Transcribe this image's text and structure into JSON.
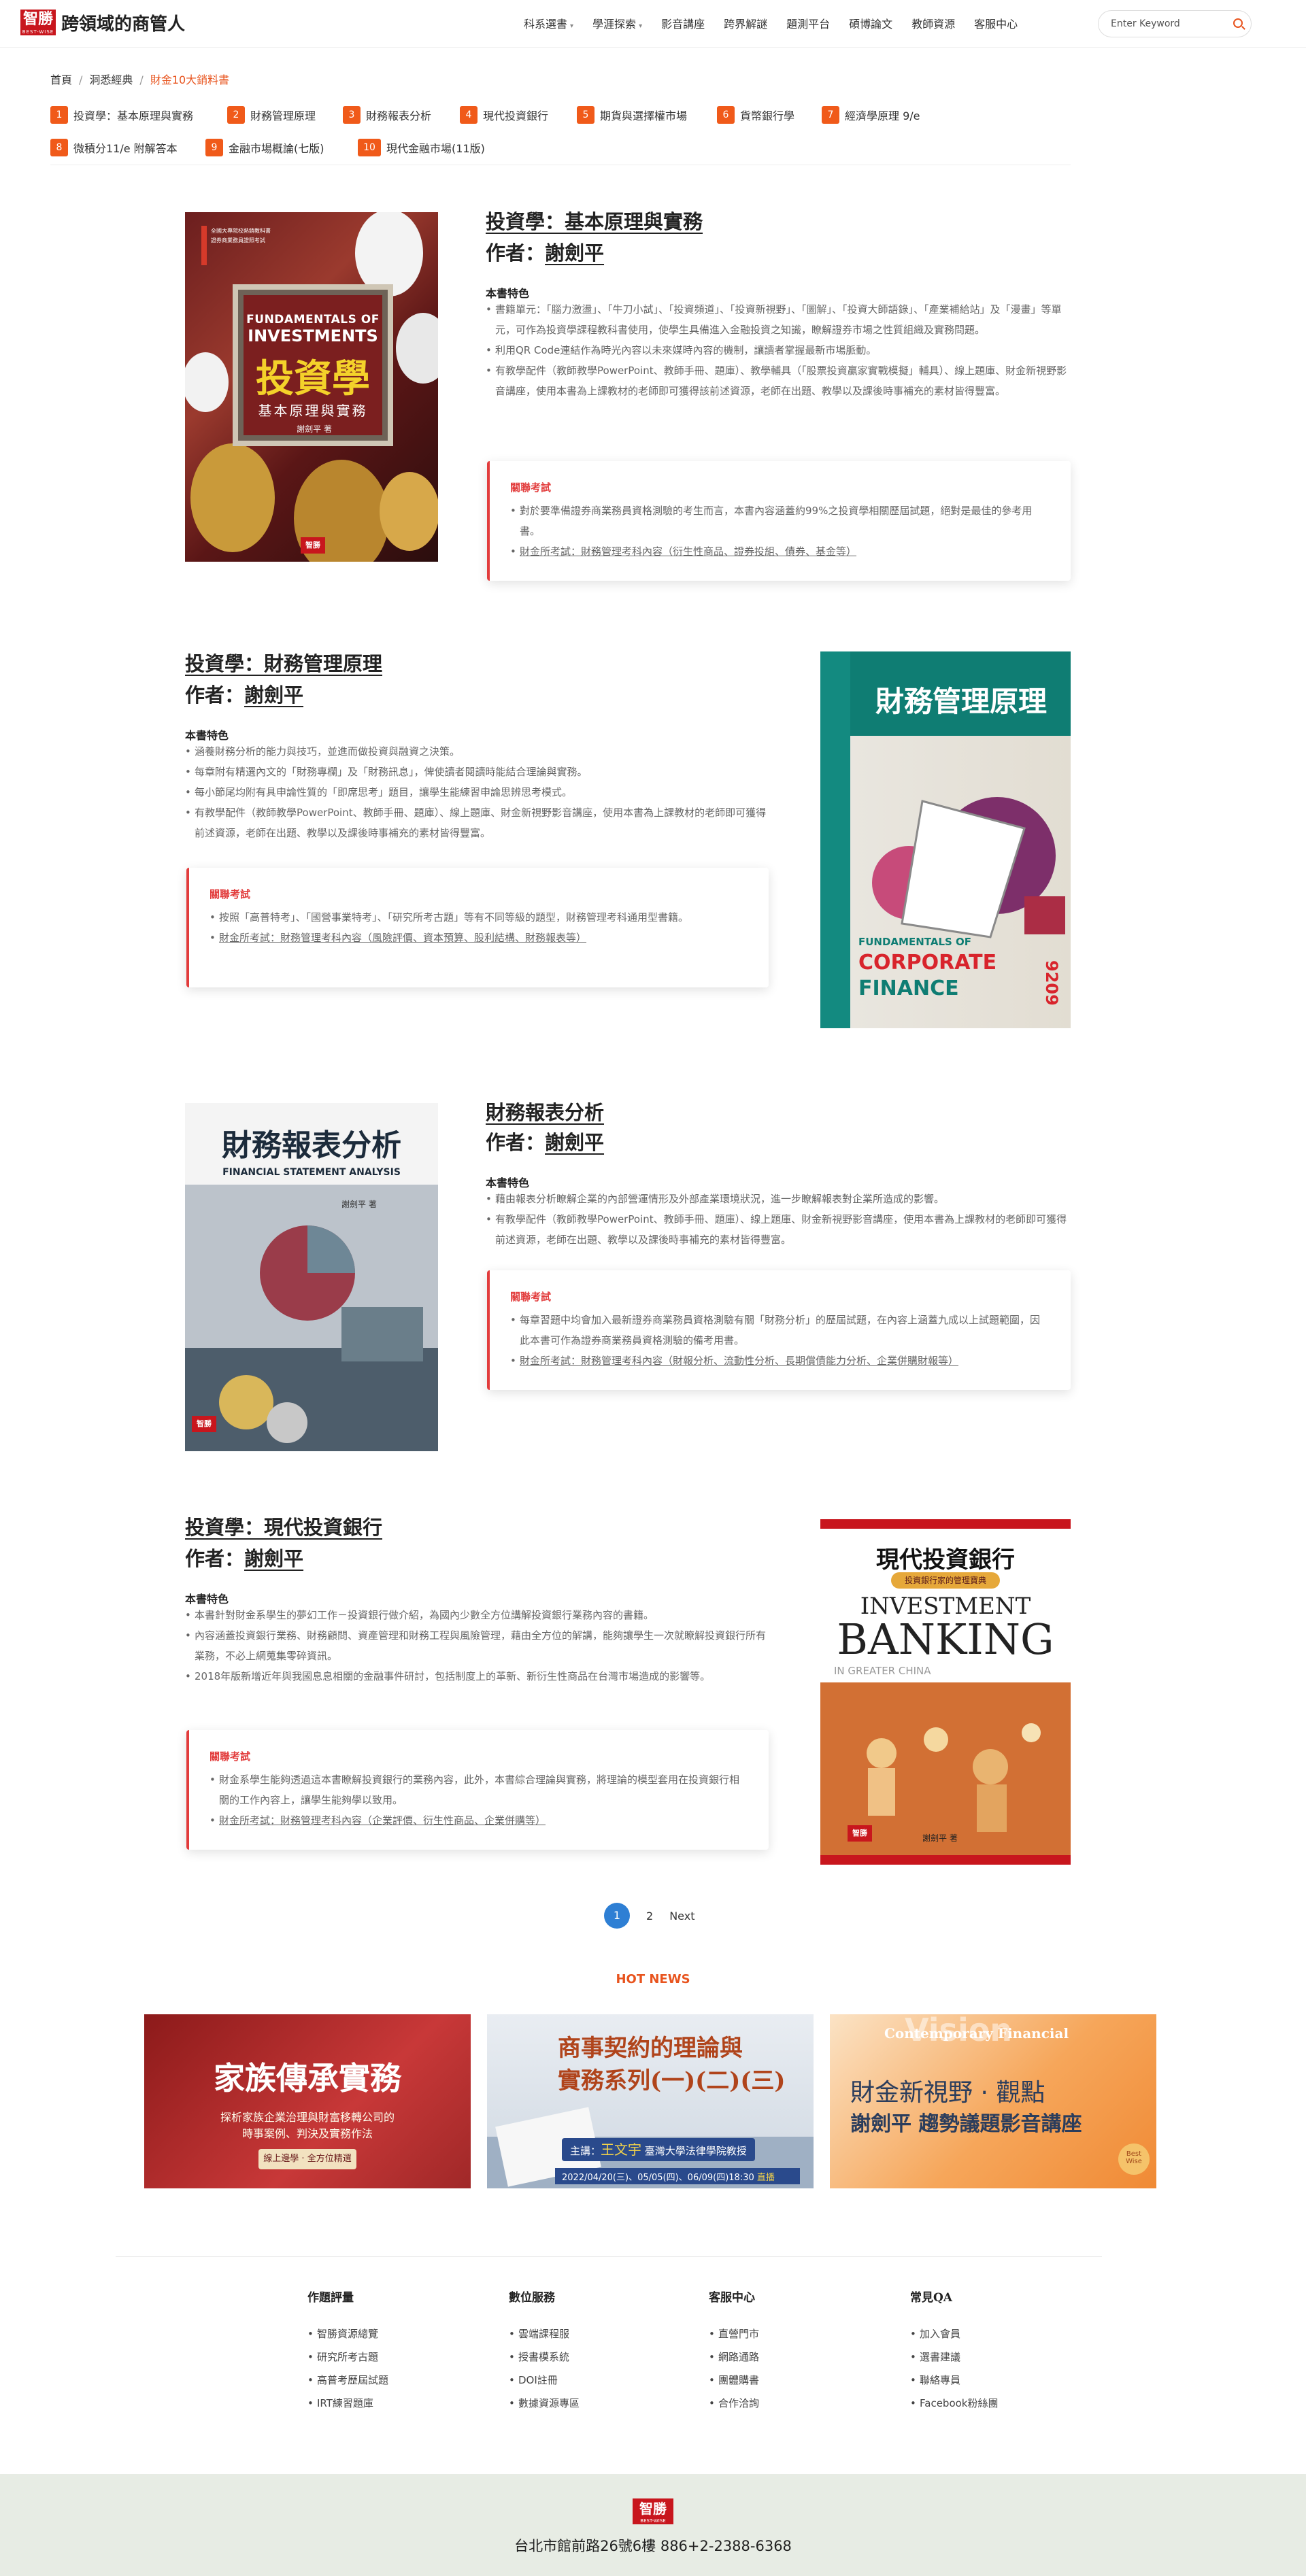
{
  "header": {
    "logo_badge": "智勝",
    "logo_sub": "BEST-WISE",
    "site_name": "跨領域的商管人",
    "nav": [
      {
        "label": "科系選書",
        "dropdown": true
      },
      {
        "label": "學涯探索",
        "dropdown": true
      },
      {
        "label": "影音講座",
        "dropdown": false
      },
      {
        "label": "跨界解謎",
        "dropdown": false
      },
      {
        "label": "題測平台",
        "dropdown": false
      },
      {
        "label": "碩博論文",
        "dropdown": false
      },
      {
        "label": "教師資源",
        "dropdown": false
      },
      {
        "label": "客服中心",
        "dropdown": false
      }
    ],
    "search_placeholder": "Enter Keyword"
  },
  "breadcrumb": {
    "home": "首頁",
    "section": "洞悉經典",
    "current": "財金10大銷料書"
  },
  "tags": [
    {
      "num": "1",
      "label": "投資學：基本原理與實務"
    },
    {
      "num": "2",
      "label": "財務管理原理"
    },
    {
      "num": "3",
      "label": "財務報表分析"
    },
    {
      "num": "4",
      "label": "現代投資銀行"
    },
    {
      "num": "5",
      "label": "期貨與選擇權市場"
    },
    {
      "num": "6",
      "label": "貨幣銀行學"
    },
    {
      "num": "7",
      "label": "經濟學原理 9/e"
    },
    {
      "num": "8",
      "label": "微積分11/e 附解答本"
    },
    {
      "num": "9",
      "label": "金融市場概論(七版)"
    },
    {
      "num": "10",
      "label": "現代金融市場(11版)"
    }
  ],
  "books": [
    {
      "title": "投資學：基本原理與實務",
      "author_prefix": "作者：",
      "author": "謝劍平",
      "feat_head": "本書特色",
      "features": [
        "書籍單元：「腦力激盪」、「牛刀小試」、「投資頻道」、「投資新視野」、「圖解」、「投資大師語錄」、「產業補給站」及「漫畫」等單元，可作為投資學課程教科書使用，使學生具備進入金融投資之知識，瞭解證券市場之性質組織及實務問題。",
        "利用QR Code連結作為時光內容以未來媒時內容的機制，讓讀者掌握最新市場脈動。",
        "有教學配件（教師教學PowerPoint、教師手冊、題庫）、教學輔具（「股票投資贏家實戰模擬」輔具）、線上題庫、財金新視野影音講座，使用本書為上課教材的老師即可獲得該前述資源，老師在出題、教學以及課後時事補充的素材皆得豐富。"
      ],
      "exam_title": "關聯考試",
      "exam_items": [
        "對於要準備證券商業務員資格測驗的考生而言，本書內容涵蓋約99%之投資學相關歷屆試題，絕對是最佳的參考用書。",
        "財金所考試：財務管理考科內容（衍生性商品、證券投組、債券、基金等）"
      ],
      "cover": {
        "en1": "FUNDAMENTALS OF",
        "en2": "INVESTMENTS",
        "zh": "投資學",
        "sub": "基本原理與實務",
        "author": "謝劍平 著"
      }
    },
    {
      "title": "投資學：財務管理原理",
      "author_prefix": "作者：",
      "author": "謝劍平",
      "feat_head": "本書特色",
      "features": [
        "涵養財務分析的能力與技巧，並進而做投資與融資之決策。",
        "每章附有精選內文的「財務專欄」及「財務訊息」，俾使讀者閱讀時能結合理論與實務。",
        "每小節尾均附有具申論性質的「即席思考」題目，讓學生能練習申論思辨思考模式。",
        "有教學配件（教師教學PowerPoint、教師手冊、題庫）、線上題庫、財金新視野影音講座，使用本書為上課教材的老師即可獲得前述資源，老師在出題、教學以及課後時事補充的素材皆得豐富。"
      ],
      "exam_title": "關聯考試",
      "exam_items": [
        "按照「高普特考」、「國營事業特考」、「研究所考古題」等有不同等級的題型，財務管理考科通用型書籍。",
        "財金所考試：財務管理考科內容（風險評價、資本預算、股利結構、財務報表等）"
      ],
      "cover": {
        "zh": "財務管理原理",
        "en1": "FUNDAMENTALS OF",
        "en2": "CORPORATE",
        "en3": "FINANCE",
        "edition": "9209"
      }
    },
    {
      "title": "財務報表分析",
      "author_prefix": "作者：",
      "author": "謝劍平",
      "feat_head": "本書特色",
      "features": [
        "藉由報表分析瞭解企業的內部營運情形及外部產業環境狀況，進一步瞭解報表對企業所造成的影響。",
        "有教學配件（教師教學PowerPoint、教師手冊、題庫）、線上題庫、財金新視野影音講座，使用本書為上課教材的老師即可獲得前述資源，老師在出題、教學以及課後時事補充的素材皆得豐富。"
      ],
      "exam_title": "關聯考試",
      "exam_items": [
        "每章習題中均會加入最新證券商業務員資格測驗有關「財務分析」的歷屆試題，在內容上涵蓋九成以上試題範圍，因此本書可作為證券商業務員資格測驗的備考用書。",
        "財金所考試：財務管理考科內容（財報分析、流動性分析、長期償債能力分析、企業併購財報等）"
      ],
      "cover": {
        "zh": "財務報表分析",
        "en": "FINANCIAL STATEMENT ANALYSIS",
        "author": "謝劍平 著"
      }
    },
    {
      "title": "投資學：現代投資銀行",
      "author_prefix": "作者：",
      "author": "謝劍平",
      "feat_head": "本書特色",
      "features": [
        "本書針對財金系學生的夢幻工作－投資銀行做介紹，為國內少數全方位講解投資銀行業務內容的書籍。",
        "內容涵蓋投資銀行業務、財務顧問、資產管理和財務工程與風險管理，藉由全方位的解講，能夠讓學生一次就瞭解投資銀行所有業務，不必上網蒐集零碎資訊。",
        "2018年版新增近年與我國息息相關的金融事件研討，包括制度上的革新、新衍生性商品在台灣市場造成的影響等。"
      ],
      "exam_title": "關聯考試",
      "exam_items": [
        "財金系學生能夠透過這本書瞭解投資銀行的業務內容，此外，本書綜合理論與實務，將理論的模型套用在投資銀行相關的工作內容上，讓學生能夠學以致用。",
        "財金所考試：財務管理考科內容（企業評價、衍生性商品、企業併購等）"
      ],
      "cover": {
        "zh": "現代投資銀行",
        "tag": "投資銀行家的管理寶典",
        "en1": "INVESTMENT",
        "en2": "BANKING",
        "en3": "IN GREATER CHINA",
        "author": "謝劍平 著"
      }
    }
  ],
  "pager": {
    "active": "1",
    "next_page": "2",
    "next_label": "Next"
  },
  "hot_news": {
    "title": "HOT NEWS",
    "banners": [
      {
        "title": "家族傳承實務",
        "sub1": "探析家族企業治理與財富移轉公司的",
        "sub2": "時事案例、判決及實務作法",
        "btn": "線上邊學 · 全方位精選"
      },
      {
        "title1": "商事契約的理論與",
        "title2": "實務系列(一)(二)(三)",
        "host_label": "主講：",
        "host": "王文宇",
        "host_title": "臺灣大學法律學院教授",
        "date": "2022/04/20(三)、05/05(四)、06/09(四)18:30",
        "live": "直播"
      },
      {
        "bg": "Vision",
        "en": "Contemporary Financial",
        "line1": "財金新視野 · 觀點",
        "line2": "謝劍平 趨勢議題影音講座",
        "brand": "Best Wise"
      }
    ]
  },
  "footer": {
    "columns": [
      {
        "title": "作題評量",
        "items": [
          "智勝資源總覽",
          "研究所考古題",
          "高普考歷屆試題",
          "IRT練習題庫"
        ]
      },
      {
        "title": "數位服務",
        "items": [
          "雲端課程服",
          "授書模系統",
          "DOI註冊",
          "數據資源專區"
        ]
      },
      {
        "title": "客服中心",
        "items": [
          "直營門市",
          "網路通路",
          "團體購書",
          "合作洽詢"
        ]
      },
      {
        "title": "常見QA",
        "items": [
          "加入會員",
          "選書建議",
          "聯絡專員",
          "Facebook粉絲團"
        ]
      }
    ],
    "logo_badge": "智勝",
    "logo_sub": "BEST-WISE",
    "address": "台北市館前路26號6樓  886+2-2388-6368"
  },
  "colors": {
    "accent": "#e8541e",
    "tag": "#f05a1a",
    "exam_border": "#e23c3c",
    "pager": "#2e7fd4",
    "brand_red": "#c8161d"
  }
}
